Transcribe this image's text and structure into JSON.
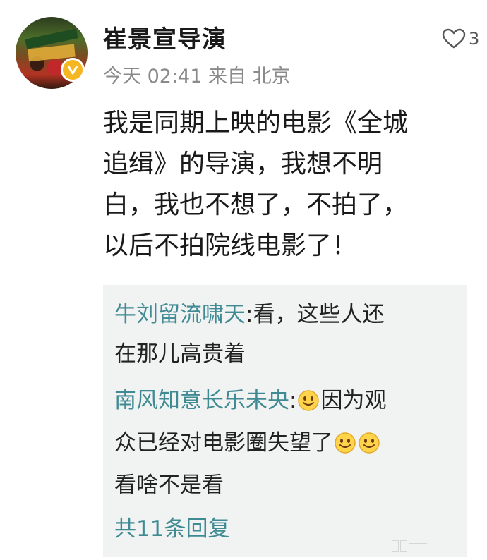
{
  "post": {
    "username": "崔景宣导演",
    "time": "今天 02:41",
    "source": "来自 北京",
    "like_count": "3",
    "content_lines": [
      "我是同期上映的电影《全城",
      "追缉》的导演，我想不明",
      "白，我也不想了，不拍了，",
      "以后不拍院线电影了！"
    ]
  },
  "replies": [
    {
      "name": "牛刘留流啸天",
      "line1": ":看，这些人还",
      "line2": "在那儿高贵着"
    },
    {
      "name": "南风知意长乐未央",
      "line1_pre": ":",
      "line1_post": "因为观",
      "line2": "众已经对电影圈失望了",
      "line3": "看啥不是看"
    }
  ],
  "more_replies": "共11条回复",
  "colors": {
    "reply_name": "#3f8a93",
    "badge": "#f6b622",
    "reply_bg": "#f1f3f3"
  }
}
